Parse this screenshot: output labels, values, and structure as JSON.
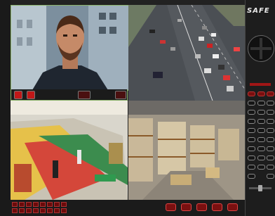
{
  "app": {
    "brand": "SAFE"
  },
  "colors": {
    "accent": "#c01818",
    "selection_border": "#8ab36a",
    "panel": "#1d1d1d"
  },
  "cameras": [
    {
      "scene": "person-portrait",
      "selected": true
    },
    {
      "scene": "traffic-highway",
      "selected": false
    },
    {
      "scene": "supermarket-aisles",
      "selected": false
    },
    {
      "scene": "warehouse-storage",
      "selected": false
    }
  ],
  "camera_toolbar_icons": [
    "speaker-icon",
    "microphone-icon",
    "record-icon",
    "snapshot-icon"
  ],
  "side_icons": [
    "ptz-joystick-icon"
  ],
  "footer_icons": [
    "record-icon",
    "play-icon",
    "stop-icon",
    "pause-icon",
    "settings-icon"
  ]
}
